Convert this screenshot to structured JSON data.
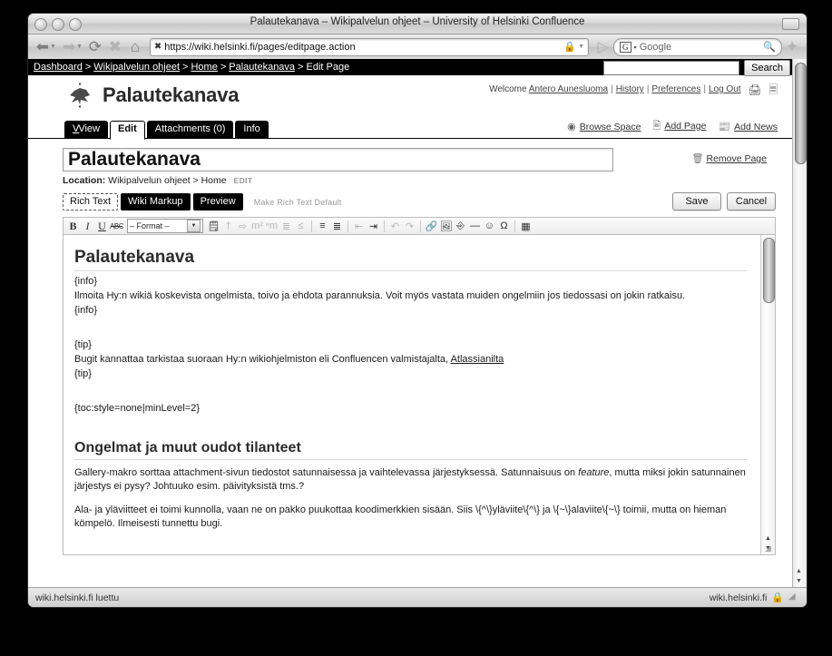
{
  "window": {
    "title": "Palautekanava – Wikipalvelun ohjeet – University of Helsinki Confluence"
  },
  "browser": {
    "url": "https://wiki.helsinki.fi/pages/editpage.action",
    "search_engine": "Google",
    "search_badge": "G",
    "icons": {
      "back": "back-arrow-icon",
      "forward": "forward-arrow-icon",
      "reload": "reload-icon",
      "stop": "stop-icon",
      "home": "home-icon",
      "lock": "lock-icon",
      "rss": "rss-icon",
      "magnifier": "magnifier-icon"
    }
  },
  "breadcrumb": {
    "items": [
      "Dashboard",
      "Wikipalvelun ohjeet",
      "Home",
      "Palautekanava",
      "Edit Page"
    ],
    "separator": ">",
    "search_value": "",
    "search_button": "Search"
  },
  "space": {
    "title": "Palautekanava",
    "welcome_prefix": "Welcome",
    "user": "Antero Aunesluoma",
    "links": [
      "History",
      "Preferences",
      "Log Out"
    ],
    "separator": "|"
  },
  "tabs": [
    {
      "label": "View",
      "active": false
    },
    {
      "label": "Edit",
      "active": true
    },
    {
      "label": "Attachments (0)",
      "active": false
    },
    {
      "label": "Info",
      "active": false
    }
  ],
  "page_tools": [
    {
      "label": "Browse Space",
      "icon": "browse-space-icon"
    },
    {
      "label": "Add Page",
      "icon": "add-page-icon"
    },
    {
      "label": "Add News",
      "icon": "add-news-icon"
    }
  ],
  "page_edit": {
    "title_value": "Palautekanava",
    "remove_page": "Remove Page",
    "location_label": "Location:",
    "location_value": "Wikipalvelun ohjeet > Home",
    "location_edit": "EDIT"
  },
  "editor": {
    "tabs": [
      {
        "label": "Rich Text",
        "selected": true
      },
      {
        "label": "Wiki Markup",
        "selected": false
      },
      {
        "label": "Preview",
        "selected": false
      }
    ],
    "make_default": "Make Rich Text Default",
    "save_label": "Save",
    "cancel_label": "Cancel",
    "format_select": "– Format –",
    "toolbar_icons": [
      "bold-icon",
      "italic-icon",
      "underline-icon",
      "strikethrough-icon",
      "format-select",
      "edit-properties-icon",
      "remove-formatting-icon",
      "insert-link-icon",
      "superscript-icon",
      "subscript-icon",
      "outdent-text-icon",
      "indent-text-icon",
      "bullet-list-icon",
      "numbered-list-icon",
      "outdent-icon",
      "indent-icon",
      "undo-icon",
      "redo-icon",
      "insert-link2-icon",
      "insert-image-icon",
      "insert-macro-icon",
      "horizontal-rule-icon",
      "emoticon-icon",
      "special-character-icon",
      "insert-table-icon"
    ]
  },
  "document": {
    "heading1": "Palautekanava",
    "block1": [
      "{info}",
      "Ilmoita Hy:n wikiä koskevista ongelmista, toivo ja ehdota parannuksia. Voit myös vastata muiden ongelmiin jos tiedossasi on jokin ratkaisu.",
      "{info}"
    ],
    "block2_open": "{tip}",
    "block2_text_pre": "Bugit kannattaa tarkistaa suoraan Hy:n wikiohjelmiston eli Confluencen valmistajalta, ",
    "block2_link": "Atlassianilta",
    "block2_close": "{tip}",
    "toc_macro": "{toc:style=none|minLevel=2}",
    "heading2": "Ongelmat ja muut oudot tilanteet",
    "para1_a": "Gallery-makro sorttaa attachment-sivun tiedostot satunnaisessa ja vaihtelevassa järjestyksessä. Satunnaisuus on ",
    "para1_em": "feature",
    "para1_b": ", mutta miksi jokin satunnainen järjestys ei pysy? Johtuuko esim. päivityksistä tms.?",
    "para2": "Ala- ja yläviitteet ei toimi kunnolla, vaan ne on pakko puukottaa koodimerkkien sisään. Siis \\{^\\}yläviite\\{^\\} ja \\{~\\}alaviite\\{~\\} toimii, mutta on hieman kömpelö. Ilmeisesti tunnettu bugi."
  },
  "status": {
    "left": "wiki.helsinki.fi luettu",
    "right": "wiki.helsinki.fi",
    "lock_icon": "lock-icon"
  }
}
